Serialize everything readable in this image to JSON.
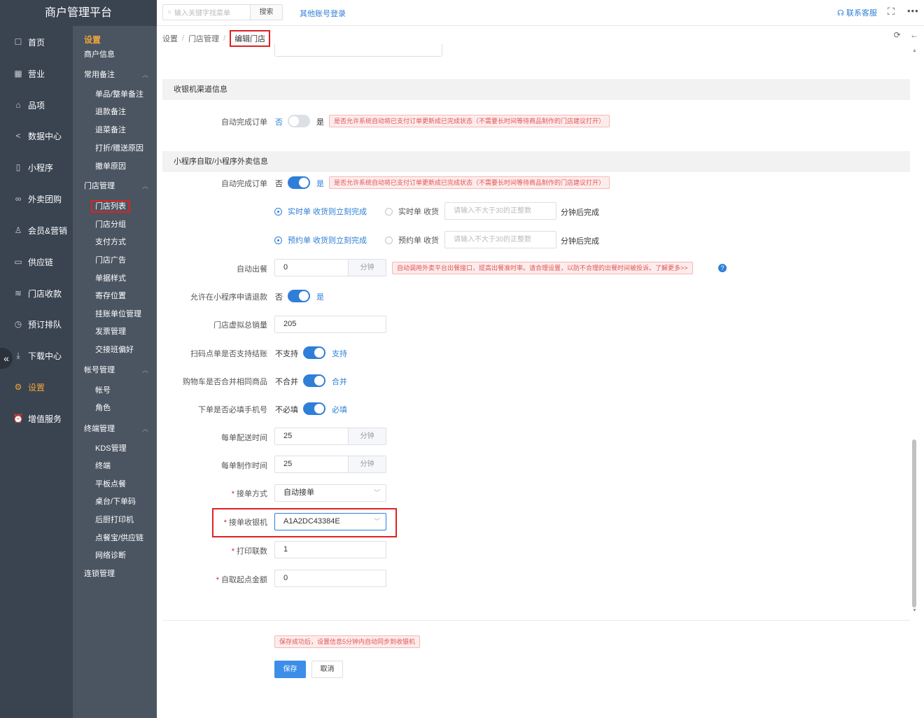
{
  "brand": "商户管理平台",
  "topbar": {
    "search_placeholder": "输入关键字找菜单",
    "search_btn": "搜索",
    "other_login": "其他账号登录",
    "contact": "联系客服"
  },
  "nav1": [
    {
      "label": "首页",
      "icon": "home-icon"
    },
    {
      "label": "营业",
      "icon": "calendar-icon"
    },
    {
      "label": "品项",
      "icon": "bag-icon"
    },
    {
      "label": "数据中心",
      "icon": "share-icon"
    },
    {
      "label": "小程序",
      "icon": "phone-icon"
    },
    {
      "label": "外卖团购",
      "icon": "bike-icon"
    },
    {
      "label": "会员&营销",
      "icon": "user-icon"
    },
    {
      "label": "供应链",
      "icon": "truck-icon"
    },
    {
      "label": "门店收款",
      "icon": "coins-icon"
    },
    {
      "label": "预订排队",
      "icon": "clock-icon"
    },
    {
      "label": "下载中心",
      "icon": "download-icon"
    },
    {
      "label": "设置",
      "icon": "gear-icon"
    },
    {
      "label": "增值服务",
      "icon": "alarm-icon"
    }
  ],
  "nav2": {
    "title": "设置",
    "items": [
      "商户信息",
      "常用备注",
      "单品/整单备注",
      "退款备注",
      "退菜备注",
      "打折/赠送原因",
      "撤单原因",
      "门店管理",
      "门店列表",
      "门店分组",
      "支付方式",
      "门店广告",
      "单据样式",
      "寄存位置",
      "挂账单位管理",
      "发票管理",
      "交接班偏好",
      "帐号管理",
      "帐号",
      "角色",
      "终端管理",
      "KDS管理",
      "终端",
      "平板点餐",
      "桌台/下单码",
      "后厨打印机",
      "点餐宝/供应链",
      "网络诊断",
      "连锁管理"
    ]
  },
  "breadcrumb": [
    "设置",
    "门店管理",
    "编辑门店"
  ],
  "form": {
    "cashier_section": "收银机渠道信息",
    "auto_complete_label": "自动完成订单",
    "no": "否",
    "yes": "是",
    "hint_auto_complete": "是否允许系统自动将已支付订单更新成已完成状态（不需要长时间等待商品制作的门店建议打开）",
    "mini_section": "小程序自取/小程序外卖信息",
    "radio_realtime_on": "实时单 收货则立刻完成",
    "radio_realtime_off": "实时单 收货",
    "radio_reserve_on": "预约单 收货则立刻完成",
    "radio_reserve_off": "预约单 收货",
    "minutes_placeholder": "请输入不大于30的正整数",
    "minutes_after": "分钟后完成",
    "auto_meal_label": "自动出餐",
    "auto_meal_value": "0",
    "unit_minute": "分钟",
    "hint_auto_meal": "自动调用外卖平台出餐接口，提高出餐准时率。请合理设置，以防不合理的出餐时间被投诉。了解更多>>",
    "refund_label": "允许在小程序申请退款",
    "virtual_sales_label": "门店虚拟总销量",
    "virtual_sales_value": "205",
    "scan_pay_label": "扫码点单是否支持结账",
    "not_support": "不支持",
    "support": "支持",
    "merge_cart_label": "购物车是否合并相同商品",
    "not_merge": "不合并",
    "merge": "合并",
    "phone_required_label": "下单是否必填手机号",
    "not_required": "不必填",
    "required": "必填",
    "delivery_time_label": "每单配送时间",
    "delivery_time_value": "25",
    "make_time_label": "每单制作时间",
    "make_time_value": "25",
    "accept_mode_label": "接单方式",
    "accept_mode_value": "自动接单",
    "accept_cashier_label": "接单收银机",
    "accept_cashier_value": "A1A2DC43384E",
    "print_copies_label": "打印联数",
    "print_copies_value": "1",
    "pickup_min_label": "自取起点金额",
    "pickup_min_value": "0",
    "save_hint": "保存成功后，设置信息5分钟内自动同步到收银机",
    "save": "保存",
    "cancel": "取消"
  },
  "colors": {
    "accent": "#2f7fd8",
    "nav_bg": "#3a4350",
    "active": "#f0a43a",
    "highlight": "#e02020"
  }
}
